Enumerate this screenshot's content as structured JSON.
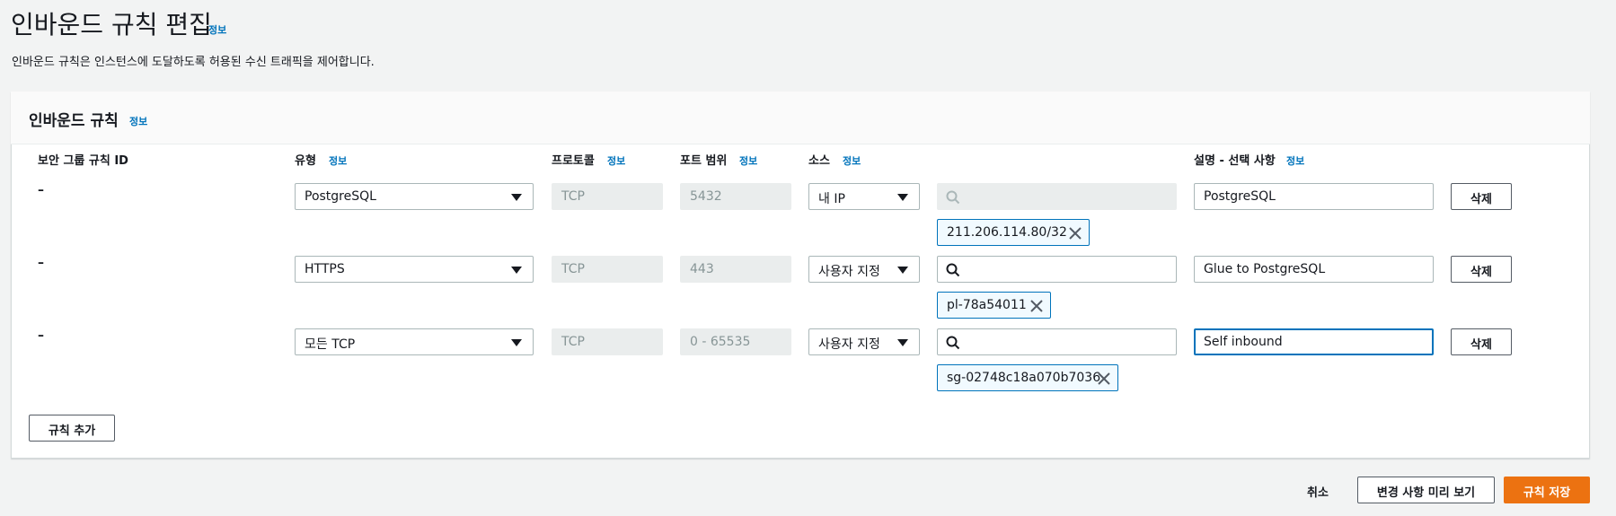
{
  "page": {
    "title": "인바운드 규칙 편집",
    "title_info": "정보",
    "description": "인바운드 규칙은 인스턴스에 도달하도록 허용된 수신 트래픽을 제어합니다."
  },
  "panel": {
    "title": "인바운드 규칙",
    "title_info": "정보",
    "columns": {
      "rule_id": "보안 그룹 규칙 ID",
      "type": "유형",
      "type_info": "정보",
      "protocol": "프로토콜",
      "protocol_info": "정보",
      "port_range": "포트 범위",
      "port_range_info": "정보",
      "source": "소스",
      "source_info": "정보",
      "description": "설명 - 선택 사항",
      "description_info": "정보"
    },
    "rules": [
      {
        "rule_id": "–",
        "type": "PostgreSQL",
        "protocol": "TCP",
        "port_range": "5432",
        "source": "내 IP",
        "source_token": "211.206.114.80/32",
        "description": "PostgreSQL",
        "delete_label": "삭제"
      },
      {
        "rule_id": "–",
        "type": "HTTPS",
        "protocol": "TCP",
        "port_range": "443",
        "source": "사용자 지정",
        "source_token": "pl-78a54011",
        "description": "Glue to PostgreSQL",
        "delete_label": "삭제"
      },
      {
        "rule_id": "–",
        "type": "모든 TCP",
        "protocol": "TCP",
        "port_range": "0 - 65535",
        "source": "사용자 지정",
        "source_token": "sg-02748c18a070b7036",
        "description": "Self inbound",
        "delete_label": "삭제"
      }
    ],
    "add_rule_label": "규칙 추가"
  },
  "footer": {
    "cancel_label": "취소",
    "preview_label": "변경 사항 미리 보기",
    "save_label": "규칙 저장"
  },
  "colors": {
    "accent": "#ec7211",
    "link": "#0073bb",
    "token_bg": "#f1faff"
  }
}
